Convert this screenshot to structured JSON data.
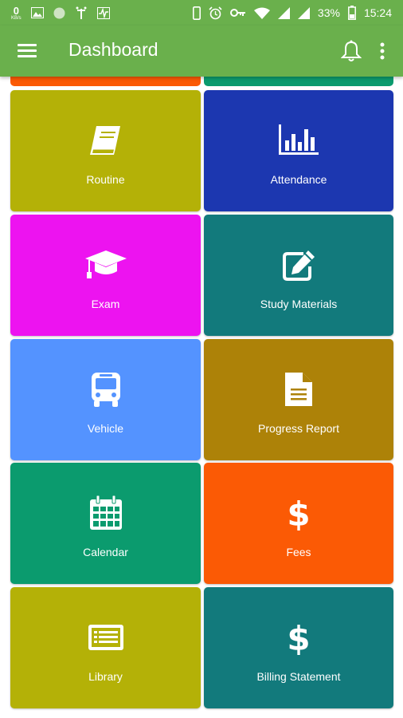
{
  "status_bar": {
    "data_rate": "0",
    "data_rate_unit": "KB/s",
    "battery_percent": "33%",
    "time": "15:24"
  },
  "app_bar": {
    "title": "Dashboard"
  },
  "partial_tiles": [
    {
      "color": "#fb5a05"
    },
    {
      "color": "#0b9b6e"
    }
  ],
  "tiles": [
    {
      "label": "Routine",
      "icon": "book-icon",
      "color": "#b4b107"
    },
    {
      "label": "Attendance",
      "icon": "bar-chart-icon",
      "color": "#1c37b0"
    },
    {
      "label": "Exam",
      "icon": "graduation-cap-icon",
      "color": "#ed13f0"
    },
    {
      "label": "Study Materials",
      "icon": "edit-icon",
      "color": "#127a7c"
    },
    {
      "label": "Vehicle",
      "icon": "bus-icon",
      "color": "#5493ff"
    },
    {
      "label": "Progress Report",
      "icon": "document-icon",
      "color": "#ad8208"
    },
    {
      "label": "Calendar",
      "icon": "calendar-icon",
      "color": "#0b9b6e"
    },
    {
      "label": "Fees",
      "icon": "dollar-icon",
      "color": "#fb5a05"
    },
    {
      "label": "Library",
      "icon": "id-card-icon",
      "color": "#b4b107"
    },
    {
      "label": "Billing Statement",
      "icon": "dollar-icon",
      "color": "#127a7c"
    }
  ]
}
